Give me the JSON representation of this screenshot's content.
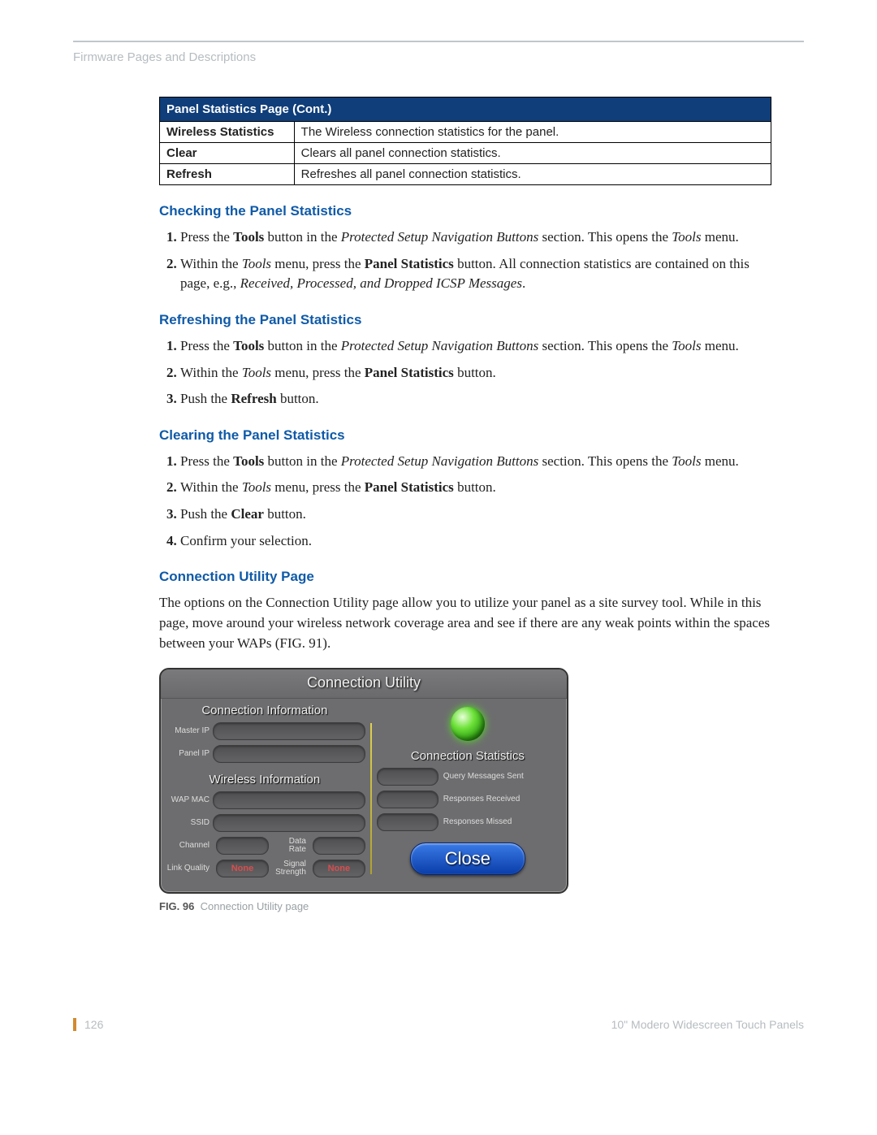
{
  "breadcrumb": "Firmware Pages and Descriptions",
  "table": {
    "title": "Panel Statistics Page (Cont.)",
    "rows": [
      {
        "label": "Wireless Statistics",
        "desc": "The Wireless connection statistics for the panel."
      },
      {
        "label": "Clear",
        "desc": "Clears all panel connection statistics."
      },
      {
        "label": "Refresh",
        "desc": "Refreshes all panel connection statistics."
      }
    ]
  },
  "sections": {
    "checking": {
      "heading": "Checking the Panel Statistics",
      "step1_pre": "Press the ",
      "step1_bold1": "Tools",
      "step1_mid": " button in the ",
      "step1_ital1": "Protected Setup Navigation Buttons",
      "step1_mid2": " section. This opens the ",
      "step1_ital2": "Tools",
      "step1_end": " menu.",
      "step2_pre": "Within the ",
      "step2_ital1": "Tools",
      "step2_mid": " menu, press the ",
      "step2_bold1": "Panel Statistics",
      "step2_mid2": " button. All connection statistics are contained on this page, e.g., ",
      "step2_ital2": "Received, Processed, and Dropped ICSP Messages",
      "step2_end": "."
    },
    "refreshing": {
      "heading": "Refreshing the Panel Statistics",
      "step1_pre": "Press the ",
      "step1_bold1": "Tools",
      "step1_mid": " button in the ",
      "step1_ital1": "Protected Setup Navigation Buttons",
      "step1_mid2": " section. This opens the ",
      "step1_ital2": "Tools",
      "step1_end": " menu.",
      "step2_pre": "Within the ",
      "step2_ital1": "Tools",
      "step2_mid": " menu, press the ",
      "step2_bold1": "Panel Statistics",
      "step2_end": " button.",
      "step3_pre": "Push the ",
      "step3_bold1": "Refresh",
      "step3_end": " button."
    },
    "clearing": {
      "heading": "Clearing the Panel Statistics",
      "step1_pre": "Press the ",
      "step1_bold1": "Tools",
      "step1_mid": " button in the ",
      "step1_ital1": "Protected Setup Navigation Buttons",
      "step1_mid2": " section. This opens the ",
      "step1_ital2": "Tools",
      "step1_end": " menu.",
      "step2_pre": "Within the ",
      "step2_ital1": "Tools",
      "step2_mid": " menu, press the ",
      "step2_bold1": "Panel Statistics",
      "step2_end": " button.",
      "step3_pre": "Push the ",
      "step3_bold1": "Clear",
      "step3_end": " button.",
      "step4": "Confirm your selection."
    },
    "connection": {
      "heading": "Connection Utility Page",
      "para": "The options on the Connection Utility page allow you to utilize your panel as a site survey tool. While in this page, move around your wireless network coverage area and see if there are any weak points within the spaces between your WAPs (FIG. 91)."
    }
  },
  "cu": {
    "title": "Connection Utility",
    "conn_info": "Connection Information",
    "master_ip": "Master IP",
    "panel_ip": "Panel IP",
    "wireless_info": "Wireless Information",
    "wap_mac": "WAP MAC",
    "ssid": "SSID",
    "channel": "Channel",
    "data_rate": "Data Rate",
    "link_quality": "Link Quality",
    "signal_strength": "Signal Strength",
    "none": "None",
    "conn_stats": "Connection Statistics",
    "query": "Query Messages Sent",
    "resp_recv": "Responses Received",
    "resp_missed": "Responses Missed",
    "close": "Close"
  },
  "figure": {
    "num": "FIG. 96",
    "caption": "Connection Utility page"
  },
  "footer": {
    "page": "126",
    "doc": "10\" Modero Widescreen Touch Panels"
  }
}
